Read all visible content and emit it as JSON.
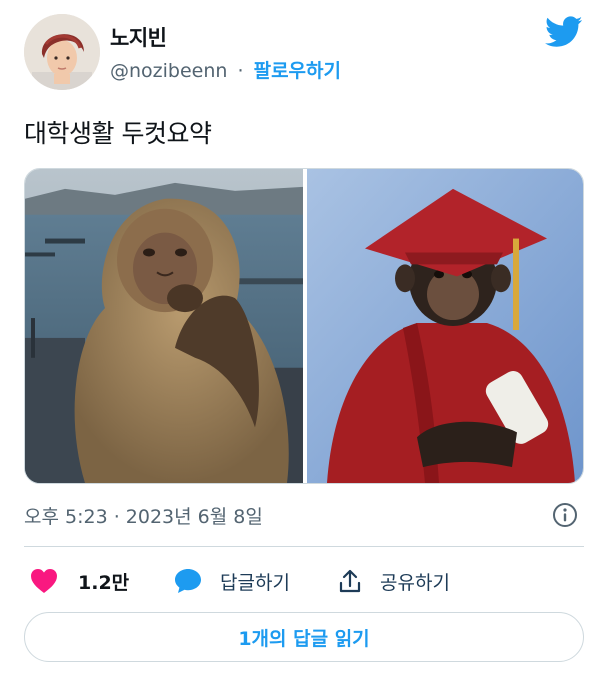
{
  "author": {
    "display_name": "노지빈",
    "handle": "@nozibeenn",
    "separator": "·",
    "follow_label": "팔로우하기"
  },
  "tweet": {
    "text": "대학생활 두컷요약",
    "timestamp": "오후 5:23 · 2023년 6월 8일"
  },
  "actions": {
    "like_count": "1.2만",
    "reply_label": "답글하기",
    "share_label": "공유하기"
  },
  "read_replies_label": "1개의 답글 읽기",
  "colors": {
    "accent": "#1d9bf0",
    "like": "#f91880",
    "text": "#0f1419",
    "muted": "#536471"
  },
  "icons": [
    "twitter-bird-icon",
    "info-icon",
    "heart-icon",
    "reply-bubble-icon",
    "share-icon"
  ]
}
